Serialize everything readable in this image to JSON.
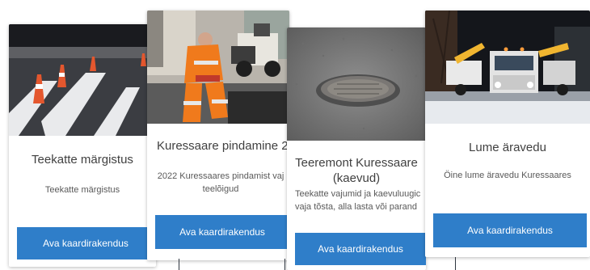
{
  "accent_color": "#2f7ec9",
  "cards": [
    {
      "title": "Teekatte märgistus",
      "description": "Teekatte märgistus",
      "button_label": "Ava kaardirakendus",
      "image": "road-marking-photo"
    },
    {
      "title": "Kuressaare pindamine 2",
      "description": "2022 Kuressaares pindamist vaj teelõigud",
      "button_label": "Ava kaardirakendus",
      "image": "road-worker-photo"
    },
    {
      "title": "Teeremont Kuressaare (kaevud)",
      "description": "Teekatte vajumid ja kaevuluugic vaja tõsta, alla lasta või parand",
      "button_label": "Ava kaardirakendus",
      "image": "manhole-photo"
    },
    {
      "title": "Lume äravedu",
      "description": "Öine lume äravedu Kuressaares",
      "button_label": "Ava kaardirakendus",
      "image": "snow-truck-photo"
    }
  ]
}
